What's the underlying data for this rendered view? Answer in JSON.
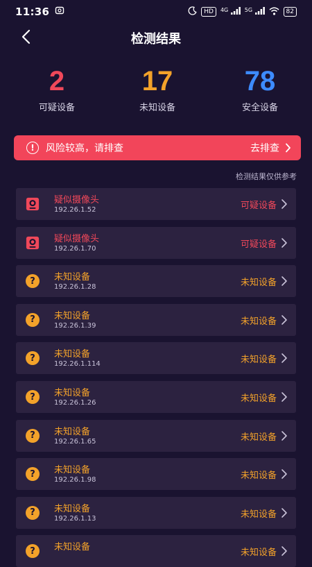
{
  "status_bar": {
    "time": "11:36",
    "hd": "HD",
    "sig1": "4G",
    "sig2": "5G",
    "battery": "82"
  },
  "header": {
    "title": "检测结果"
  },
  "stats": [
    {
      "value": "2",
      "label": "可疑设备",
      "color": "#f0485a"
    },
    {
      "value": "17",
      "label": "未知设备",
      "color": "#f3a22a"
    },
    {
      "value": "78",
      "label": "安全设备",
      "color": "#3d8bff"
    }
  ],
  "alert": {
    "text": "风险较高，请排查",
    "action": "去排查"
  },
  "note": "检测结果仅供参考",
  "devices": [
    {
      "name": "疑似摄像头",
      "ip": "192.26.1.52",
      "status": "可疑设备",
      "type": "camera-icon"
    },
    {
      "name": "疑似摄像头",
      "ip": "192.26.1.70",
      "status": "可疑设备",
      "type": "camera-icon"
    },
    {
      "name": "未知设备",
      "ip": "192.26.1.28",
      "status": "未知设备",
      "type": "question-icon"
    },
    {
      "name": "未知设备",
      "ip": "192.26.1.39",
      "status": "未知设备",
      "type": "question-icon"
    },
    {
      "name": "未知设备",
      "ip": "192.26.1.114",
      "status": "未知设备",
      "type": "question-icon"
    },
    {
      "name": "未知设备",
      "ip": "192.26.1.26",
      "status": "未知设备",
      "type": "question-icon"
    },
    {
      "name": "未知设备",
      "ip": "192.26.1.65",
      "status": "未知设备",
      "type": "question-icon"
    },
    {
      "name": "未知设备",
      "ip": "192.26.1.98",
      "status": "未知设备",
      "type": "question-icon"
    },
    {
      "name": "未知设备",
      "ip": "192.26.1.13",
      "status": "未知设备",
      "type": "question-icon"
    },
    {
      "name": "未知设备",
      "ip": "",
      "status": "未知设备",
      "type": "question-icon"
    }
  ]
}
